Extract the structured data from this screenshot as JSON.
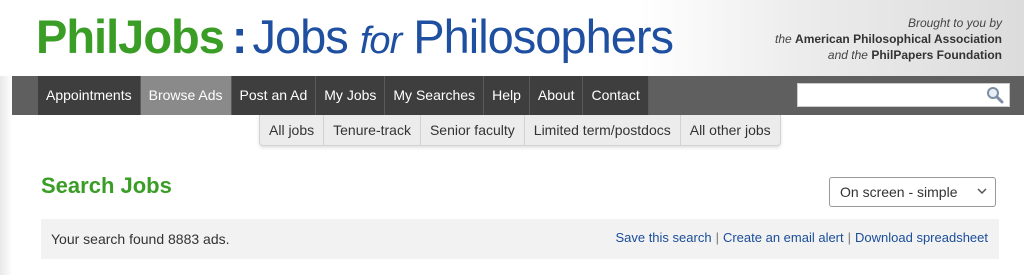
{
  "header": {
    "logo": {
      "part1": "PhilJobs",
      "colon": ":",
      "part2": "Jobs",
      "part3": "for",
      "part4": "Philosophers"
    },
    "credits": {
      "line1": "Brought to you by",
      "line2_prefix": "the",
      "line2_org": "American Philosophical Association",
      "line3_prefix": "and the",
      "line3_org": "PhilPapers Foundation"
    }
  },
  "nav": {
    "items": [
      {
        "label": "Appointments",
        "active": false
      },
      {
        "label": "Browse Ads",
        "active": true
      },
      {
        "label": "Post an Ad",
        "active": false
      },
      {
        "label": "My Jobs",
        "active": false
      },
      {
        "label": "My Searches",
        "active": false
      },
      {
        "label": "Help",
        "active": false
      },
      {
        "label": "About",
        "active": false
      },
      {
        "label": "Contact",
        "active": false
      }
    ],
    "search": {
      "value": "",
      "placeholder": "",
      "icon": "magnifier-icon"
    }
  },
  "subnav": {
    "items": [
      "All jobs",
      "Tenure-track",
      "Senior faculty",
      "Limited term/postdocs",
      "All other jobs"
    ]
  },
  "main": {
    "title": "Search Jobs",
    "view_select": {
      "selected": "On screen - simple"
    },
    "results": {
      "summary": "Your search found 8883 ads.",
      "links": [
        "Save this search",
        "Create an email alert",
        "Download spreadsheet"
      ],
      "separator": "|"
    }
  },
  "colors": {
    "brand_green": "#3a9d26",
    "brand_blue": "#1e4fa0",
    "nav_bg": "#3e3e3e",
    "nav_active": "#8a8a8a",
    "link": "#1a4d99"
  }
}
